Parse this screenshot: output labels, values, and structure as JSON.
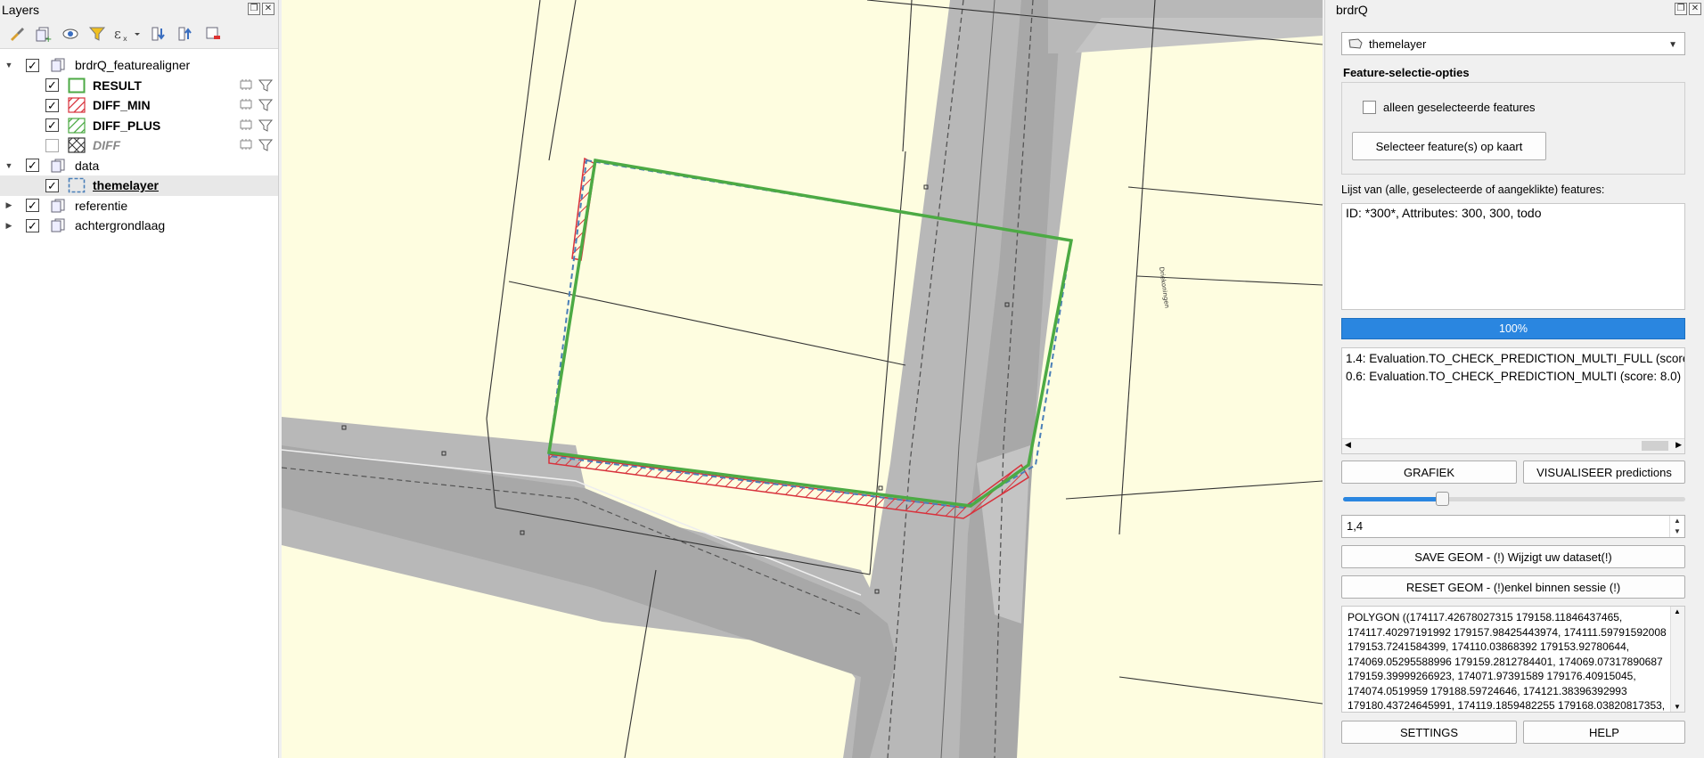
{
  "layers_panel": {
    "title": "Layers",
    "tree": [
      {
        "name": "brdrQ_featurealigner",
        "type": "group",
        "expanded": true,
        "checked": true
      },
      {
        "name": "RESULT",
        "type": "layer",
        "checked": true,
        "symbol": "result",
        "style": "bold"
      },
      {
        "name": "DIFF_MIN",
        "type": "layer",
        "checked": true,
        "symbol": "diff-min",
        "style": "bold"
      },
      {
        "name": "DIFF_PLUS",
        "type": "layer",
        "checked": true,
        "symbol": "diff-plus",
        "style": "bold"
      },
      {
        "name": "DIFF",
        "type": "layer",
        "checked": false,
        "symbol": "diff",
        "style": "italic"
      },
      {
        "name": "data",
        "type": "group",
        "expanded": true,
        "checked": true
      },
      {
        "name": "themelayer",
        "type": "layer",
        "checked": true,
        "symbol": "themelayer",
        "style": "bold-underline"
      },
      {
        "name": "referentie",
        "type": "group",
        "expanded": false,
        "checked": true
      },
      {
        "name": "achtergrondlaag",
        "type": "group",
        "expanded": false,
        "checked": true
      }
    ]
  },
  "map": {
    "street_label": "Driekoningen"
  },
  "brdrq": {
    "title": "brdrQ",
    "layer_combo": "themelayer",
    "group_title": "Feature-selectie-opties",
    "only_selected_label": "alleen geselecteerde features",
    "select_button": "Selecteer feature(s) op kaart",
    "list_label": "Lijst van (alle, geselecteerde of aangeklikte) features:",
    "features": [
      "ID: *300*, Attributes: 300, 300, todo"
    ],
    "progress_text": "100%",
    "progress": 1.0,
    "predictions": [
      "1.4: Evaluation.TO_CHECK_PREDICTION_MULTI_FULL (score: 8.0)",
      "0.6: Evaluation.TO_CHECK_PREDICTION_MULTI (score: 8.0)"
    ],
    "grafiek_button": "GRAFIEK",
    "visualiseer_button": "VISUALISEER predictions",
    "slider_value": 0.29,
    "spin_value": "1,4",
    "save_button": "SAVE GEOM - (!) Wijzigt uw dataset(!)",
    "reset_button": "RESET GEOM - (!)enkel binnen sessie (!)",
    "wkt": "POLYGON ((174117.42678027315 179158.11846437465, 174117.40297191992 179157.98425443974, 174111.59791592008 179153.7241584399, 174110.03868392 179153.92780644, 174069.05295588996 179159.2812784401, 174069.07317890687 179159.39999266923, 174071.97391589 179176.40915045, 174074.0519959 179188.59724646, 174121.38396392993 179180.43724645991, 174119.1859482255 179168.03820817353,",
    "settings_button": "SETTINGS",
    "help_button": "HELP"
  },
  "colors": {
    "parcel_fill": "#fefde0",
    "road": "#b4b4b4",
    "result_green": "#4caa44",
    "diff_red": "#d8323c",
    "theme_blue": "#4a7fb8",
    "progress_blue": "#2a86e0"
  }
}
